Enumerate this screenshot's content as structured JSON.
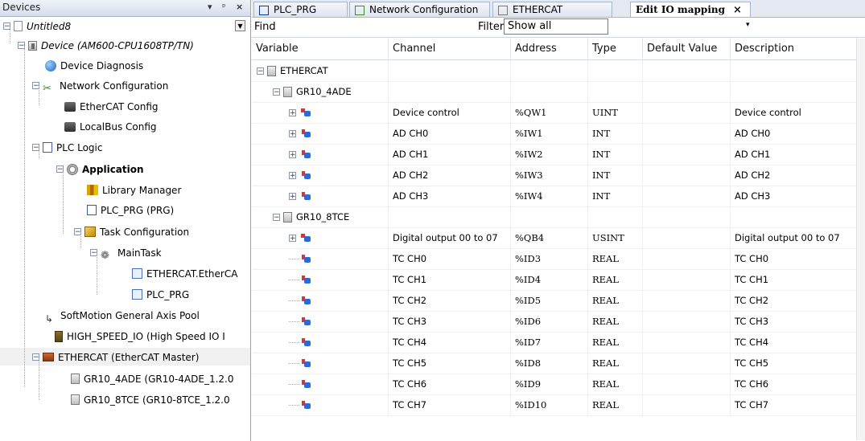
{
  "devices_panel": {
    "title": "Devices",
    "controls": {
      "pin": "▾",
      "float": "ᵖ",
      "close": "×"
    },
    "tree": [
      {
        "label": "Untitled8",
        "icon": "project-icon",
        "italic": true
      },
      {
        "label": "Device (AM600-CPU1608TP/TN)",
        "icon": "device-icon",
        "italic": true
      },
      {
        "label": "Device Diagnosis",
        "icon": "diagnosis-icon"
      },
      {
        "label": "Network Configuration",
        "icon": "network-config-icon"
      },
      {
        "label": "EtherCAT Config",
        "icon": "ethercat-config-icon"
      },
      {
        "label": "LocalBus Config",
        "icon": "localbus-config-icon"
      },
      {
        "label": "PLC Logic",
        "icon": "plc-logic-icon"
      },
      {
        "label": "Application",
        "icon": "application-icon",
        "bold": true
      },
      {
        "label": "Library Manager",
        "icon": "library-manager-icon"
      },
      {
        "label": "PLC_PRG (PRG)",
        "icon": "program-icon"
      },
      {
        "label": "Task Configuration",
        "icon": "task-config-icon"
      },
      {
        "label": "MainTask",
        "icon": "main-task-icon"
      },
      {
        "label": "ETHERCAT.EtherCA",
        "icon": "ethercat-call-icon"
      },
      {
        "label": "PLC_PRG",
        "icon": "program-call-icon"
      },
      {
        "label": "SoftMotion General Axis Pool",
        "icon": "softmotion-icon"
      },
      {
        "label": "HIGH_SPEED_IO (High Speed IO I",
        "icon": "high-speed-io-icon"
      },
      {
        "label": "ETHERCAT (EtherCAT Master)",
        "icon": "ethercat-master-icon"
      },
      {
        "label": "GR10_4ADE (GR10-4ADE_1.2.0",
        "icon": "module-icon"
      },
      {
        "label": "GR10_8TCE (GR10-8TCE_1.2.0",
        "icon": "module-icon"
      }
    ]
  },
  "editor": {
    "tabs": [
      {
        "label": "PLC_PRG",
        "icon": "program-icon"
      },
      {
        "label": "Network Configuration",
        "icon": "network-config-icon"
      },
      {
        "label": "ETHERCAT",
        "icon": "device-icon"
      },
      {
        "label": "Edit IO mapping",
        "close": "×",
        "active": true
      }
    ],
    "toolbar": {
      "find_label": "Find",
      "filter_label": "Filter",
      "filter_value": "Show all",
      "filter_arrow": "▾"
    },
    "columns": [
      "Variable",
      "Channel",
      "Address",
      "Type",
      "Default Value",
      "Description"
    ],
    "rows": [
      {
        "kind": "group",
        "level": 0,
        "name": "ETHERCAT"
      },
      {
        "kind": "group",
        "level": 1,
        "name": "GR10_4ADE"
      },
      {
        "kind": "io",
        "dir": "out",
        "expand": true,
        "channel": "Device control",
        "address": "%QW1",
        "type": "UINT",
        "default": "",
        "description": "Device control"
      },
      {
        "kind": "io",
        "dir": "in",
        "expand": true,
        "channel": "AD CH0",
        "address": "%IW1",
        "type": "INT",
        "default": "",
        "description": "AD CH0"
      },
      {
        "kind": "io",
        "dir": "in",
        "expand": true,
        "channel": "AD CH1",
        "address": "%IW2",
        "type": "INT",
        "default": "",
        "description": "AD CH1"
      },
      {
        "kind": "io",
        "dir": "in",
        "expand": true,
        "channel": "AD CH2",
        "address": "%IW3",
        "type": "INT",
        "default": "",
        "description": "AD CH2"
      },
      {
        "kind": "io",
        "dir": "in",
        "expand": true,
        "channel": "AD CH3",
        "address": "%IW4",
        "type": "INT",
        "default": "",
        "description": "AD CH3"
      },
      {
        "kind": "group",
        "level": 1,
        "name": "GR10_8TCE"
      },
      {
        "kind": "io",
        "dir": "out",
        "expand": true,
        "channel": "Digital output 00 to 07",
        "address": "%QB4",
        "type": "USINT",
        "default": "",
        "description": "Digital output 00 to 07"
      },
      {
        "kind": "io",
        "dir": "in",
        "expand": false,
        "channel": "TC CH0",
        "address": "%ID3",
        "type": "REAL",
        "default": "",
        "description": "TC CH0"
      },
      {
        "kind": "io",
        "dir": "in",
        "expand": false,
        "channel": "TC CH1",
        "address": "%ID4",
        "type": "REAL",
        "default": "",
        "description": "TC CH1"
      },
      {
        "kind": "io",
        "dir": "in",
        "expand": false,
        "channel": "TC CH2",
        "address": "%ID5",
        "type": "REAL",
        "default": "",
        "description": "TC CH2"
      },
      {
        "kind": "io",
        "dir": "in",
        "expand": false,
        "channel": "TC CH3",
        "address": "%ID6",
        "type": "REAL",
        "default": "",
        "description": "TC CH3"
      },
      {
        "kind": "io",
        "dir": "in",
        "expand": false,
        "channel": "TC CH4",
        "address": "%ID7",
        "type": "REAL",
        "default": "",
        "description": "TC CH4"
      },
      {
        "kind": "io",
        "dir": "in",
        "expand": false,
        "channel": "TC CH5",
        "address": "%ID8",
        "type": "REAL",
        "default": "",
        "description": "TC CH5"
      },
      {
        "kind": "io",
        "dir": "in",
        "expand": false,
        "channel": "TC CH6",
        "address": "%ID9",
        "type": "REAL",
        "default": "",
        "description": "TC CH6"
      },
      {
        "kind": "io",
        "dir": "in",
        "expand": false,
        "channel": "TC CH7",
        "address": "%ID10",
        "type": "REAL",
        "default": "",
        "description": "TC CH7"
      }
    ]
  }
}
